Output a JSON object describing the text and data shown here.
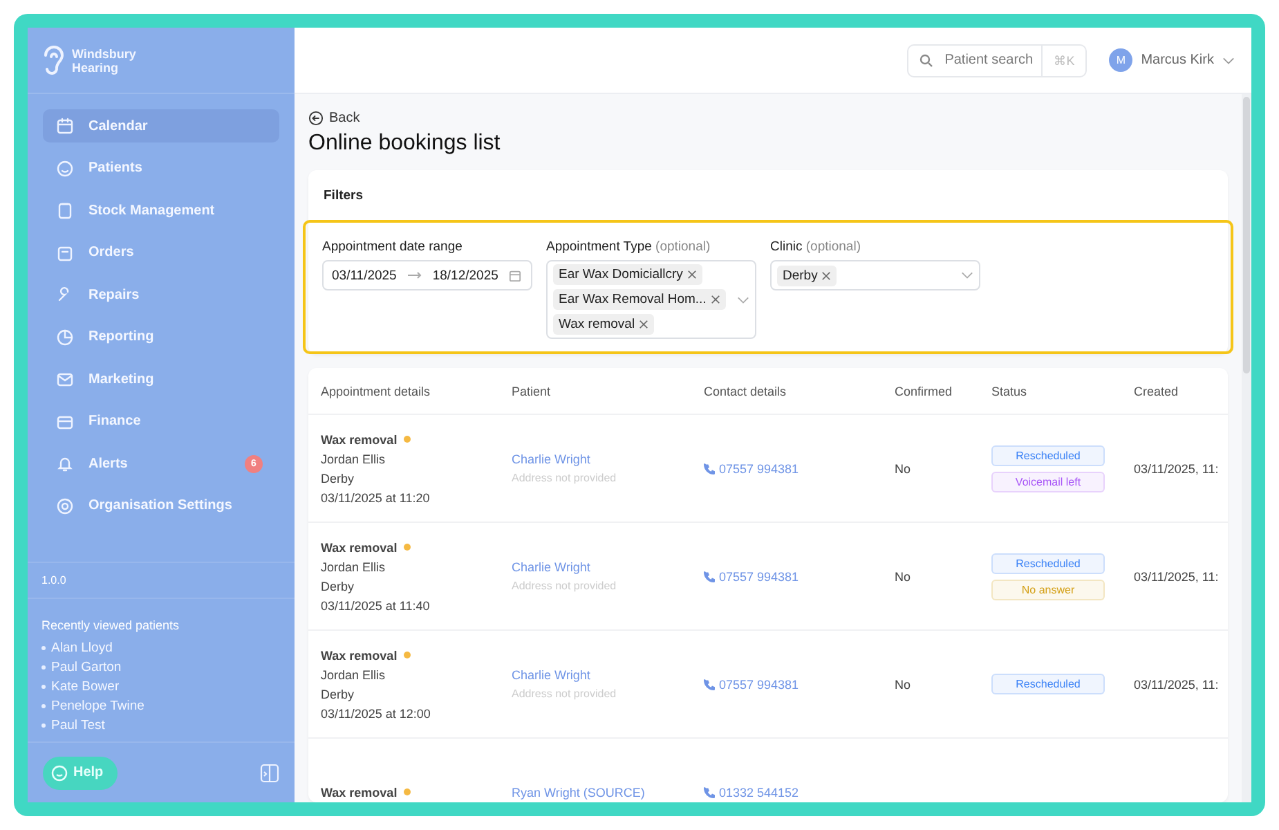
{
  "brand": {
    "line1": "Windsbury",
    "line2": "Hearing"
  },
  "sidebar": {
    "items": [
      {
        "label": "Calendar",
        "selected": true
      },
      {
        "label": "Patients",
        "selected": false
      },
      {
        "label": "Stock Management",
        "selected": false
      },
      {
        "label": "Orders",
        "selected": false
      },
      {
        "label": "Repairs",
        "selected": false
      },
      {
        "label": "Reporting",
        "selected": false
      },
      {
        "label": "Marketing",
        "selected": false
      },
      {
        "label": "Finance",
        "selected": false
      },
      {
        "label": "Alerts",
        "selected": false,
        "badge": "6"
      },
      {
        "label": "Organisation Settings",
        "selected": false
      }
    ],
    "version": "1.0.0",
    "recent_title": "Recently viewed patients",
    "recent": [
      "Alan Lloyd",
      "Paul Garton",
      "Kate Bower",
      "Penelope Twine",
      "Paul Test"
    ],
    "help": "Help"
  },
  "topbar": {
    "search_placeholder": "Patient search",
    "shortcut": "⌘K",
    "user_initial": "M",
    "user_name": "Marcus Kirk"
  },
  "back": "Back",
  "title": "Online bookings list",
  "filters": {
    "heading": "Filters",
    "date_range": {
      "label": "Appointment date range",
      "from": "03/11/2025",
      "to": "18/12/2025"
    },
    "appointment_type": {
      "label": "Appointment Type",
      "optional": "(optional)",
      "tags": [
        "Ear Wax Domiciallcry",
        "Ear Wax Removal Hom...",
        "Wax removal"
      ]
    },
    "clinic": {
      "label": "Clinic",
      "optional": "(optional)",
      "tags": [
        "Derby"
      ]
    }
  },
  "table": {
    "columns": [
      "Appointment details",
      "Patient",
      "Contact details",
      "Confirmed",
      "Status",
      "Created"
    ],
    "rows": [
      {
        "type": "Wax removal",
        "practitioner": "Jordan Ellis",
        "clinic": "Derby",
        "when": "03/11/2025 at 11:20",
        "patient": "Charlie Wright",
        "address": "Address not provided",
        "phone": "07557 994381",
        "confirmed": "No",
        "statuses": [
          {
            "label": "Rescheduled",
            "color": "#3b82f6"
          },
          {
            "label": "Voicemail left",
            "color": "#a855f7"
          }
        ],
        "created": "03/11/2025, 11:"
      },
      {
        "type": "Wax removal",
        "practitioner": "Jordan Ellis",
        "clinic": "Derby",
        "when": "03/11/2025 at 11:40",
        "patient": "Charlie Wright",
        "address": "Address not provided",
        "phone": "07557 994381",
        "confirmed": "No",
        "statuses": [
          {
            "label": "Rescheduled",
            "color": "#3b82f6"
          },
          {
            "label": "No answer",
            "color": "#d4a017"
          }
        ],
        "created": "03/11/2025, 11:"
      },
      {
        "type": "Wax removal",
        "practitioner": "Jordan Ellis",
        "clinic": "Derby",
        "when": "03/11/2025 at 12:00",
        "patient": "Charlie Wright",
        "address": "Address not provided",
        "phone": "07557 994381",
        "confirmed": "No",
        "statuses": [
          {
            "label": "Rescheduled",
            "color": "#3b82f6"
          }
        ],
        "created": "03/11/2025, 11:"
      },
      {
        "type": "Wax removal",
        "patient": "Ryan Wright (SOURCE)",
        "phone": "01332 544152",
        "statuses": []
      }
    ]
  }
}
